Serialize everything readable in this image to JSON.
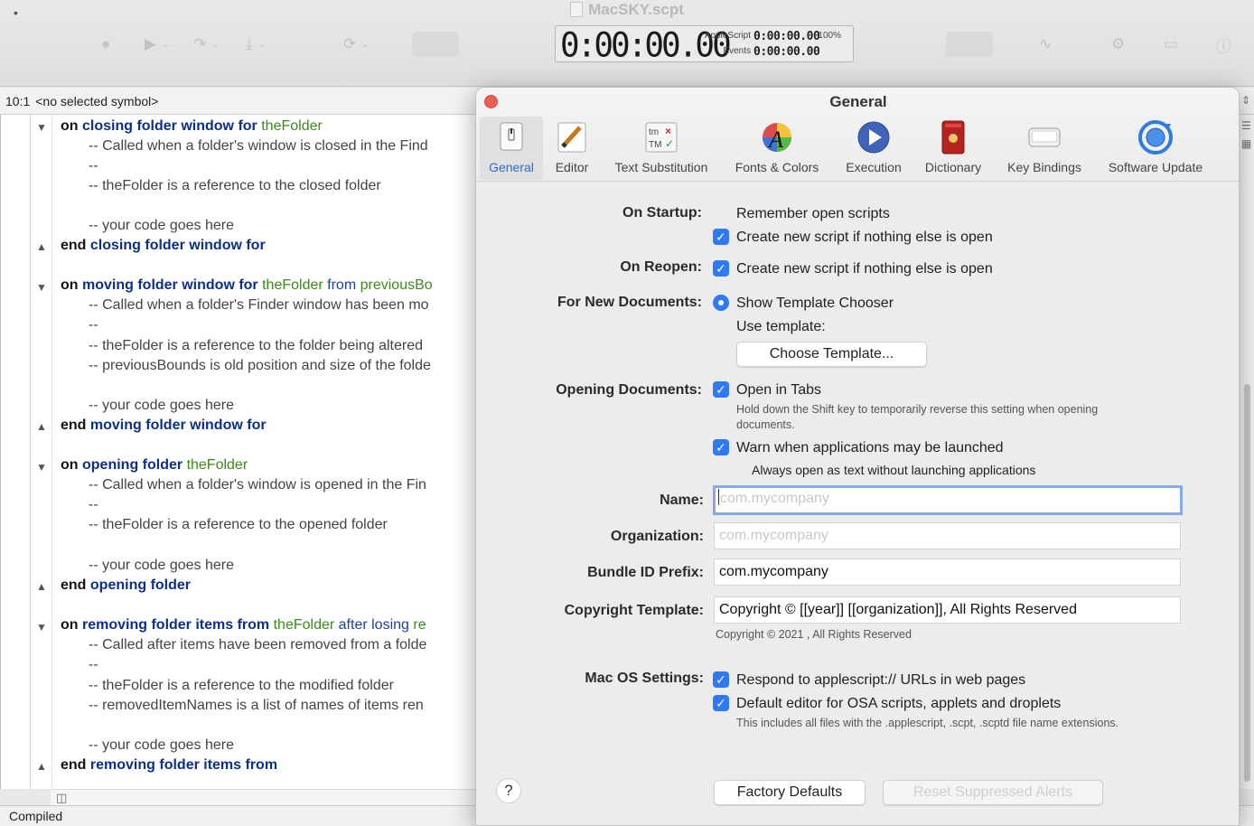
{
  "window": {
    "title": "MacSKY.scpt",
    "doc_marker": "•"
  },
  "timer": {
    "main": "0:00:00.00",
    "applescript_label": "AppleScript",
    "applescript_value": "0:00:00.00",
    "percent": "100%",
    "events_label": "Events",
    "events_value": "0:00:00.00"
  },
  "symbol_bar": {
    "position": "10:1",
    "symbol": "<no selected symbol>"
  },
  "code": {
    "l1": {
      "kw": "on",
      "hd": "closing folder window for",
      "var": "theFolder"
    },
    "l2": "--   Called when a folder's window is closed in the Find",
    "l3": "--",
    "l4": "--   theFolder is a reference to the closed folder",
    "l5": "-- your code goes here",
    "l6": {
      "kw": "end",
      "hd": "closing folder window for"
    },
    "l7": {
      "kw": "on",
      "hd": "moving folder window for",
      "var": "theFolder",
      "vb": "from",
      "var2": "previousBo"
    },
    "l8": "--   Called when a folder's Finder window has been mo",
    "l9": "--",
    "l10": "--   theFolder is a reference to the folder being altered",
    "l11": "--   previousBounds is old position and size of the folde",
    "l12": "-- your code goes here",
    "l13": {
      "kw": "end",
      "hd": "moving folder window for"
    },
    "l14": {
      "kw": "on",
      "hd": "opening folder",
      "var": "theFolder"
    },
    "l15": "--   Called when a folder's window is opened in the Fin",
    "l16": "--",
    "l17": "--   theFolder is a reference to the opened folder",
    "l18": "-- your code goes here",
    "l19": {
      "kw": "end",
      "hd": "opening folder"
    },
    "l20": {
      "kw": "on",
      "hd": "removing folder items from",
      "var": "theFolder",
      "vb": "after losing",
      "var2": "re"
    },
    "l21": "--   Called after items have been removed from a folde",
    "l22": "--",
    "l23": "--   theFolder is a reference to the modified folder",
    "l24": "--   removedItemNames is a list of names of items ren",
    "l25": "-- your code goes here",
    "l26": {
      "kw": "end",
      "hd": "removing folder items from"
    }
  },
  "status": "Compiled",
  "prefs": {
    "title": "General",
    "tabs": [
      {
        "label": "General",
        "icon": "general-switch-icon"
      },
      {
        "label": "Editor",
        "icon": "pencil-icon"
      },
      {
        "label": "Text Substitution",
        "icon": "text-substitution-icon"
      },
      {
        "label": "Fonts & Colors",
        "icon": "color-wheel-icon"
      },
      {
        "label": "Execution",
        "icon": "play-icon"
      },
      {
        "label": "Dictionary",
        "icon": "dictionary-book-icon"
      },
      {
        "label": "Key Bindings",
        "icon": "keyboard-key-icon"
      },
      {
        "label": "Software Update",
        "icon": "sync-globe-icon"
      }
    ],
    "on_startup_label": "On Startup:",
    "remember_open_scripts": "Remember open scripts",
    "create_new_script": "Create new script if nothing else is open",
    "on_reopen_label": "On Reopen:",
    "create_new_script_reopen": "Create new script if nothing else is open",
    "for_new_documents_label": "For New Documents:",
    "show_template_chooser": "Show Template Chooser",
    "use_template": "Use template:",
    "choose_template_button": "Choose Template...",
    "opening_documents_label": "Opening Documents:",
    "open_in_tabs": "Open in Tabs",
    "open_in_tabs_hint": "Hold down the Shift key to temporarily reverse this setting when opening documents.",
    "warn_launched": "Warn when applications may be launched",
    "always_open_text": "Always open as text without launching applications",
    "name_label": "Name:",
    "name_placeholder": "com.mycompany",
    "organization_label": "Organization:",
    "organization_placeholder": "com.mycompany",
    "bundle_label": "Bundle ID Prefix:",
    "bundle_value": "com.mycompany",
    "copyright_label": "Copyright Template:",
    "copyright_value": "Copyright © [[year]] [[organization]], All Rights Reserved",
    "copyright_preview": "Copyright © 2021 , All Rights Reserved",
    "macos_label": "Mac OS Settings:",
    "respond_urls": "Respond to applescript:// URLs in web pages",
    "default_editor": "Default editor for OSA scripts, applets and droplets",
    "default_editor_hint": "This includes all files with the .applescript, .scpt, .scptd file name extensions.",
    "factory_defaults_button": "Factory Defaults",
    "reset_alerts_button": "Reset Suppressed Alerts",
    "help": "?"
  },
  "colors": {
    "accent": "#2f79f4",
    "handler_name": "#0c2f8a",
    "variable": "#3b8a1b",
    "close": "#ec5f57"
  }
}
